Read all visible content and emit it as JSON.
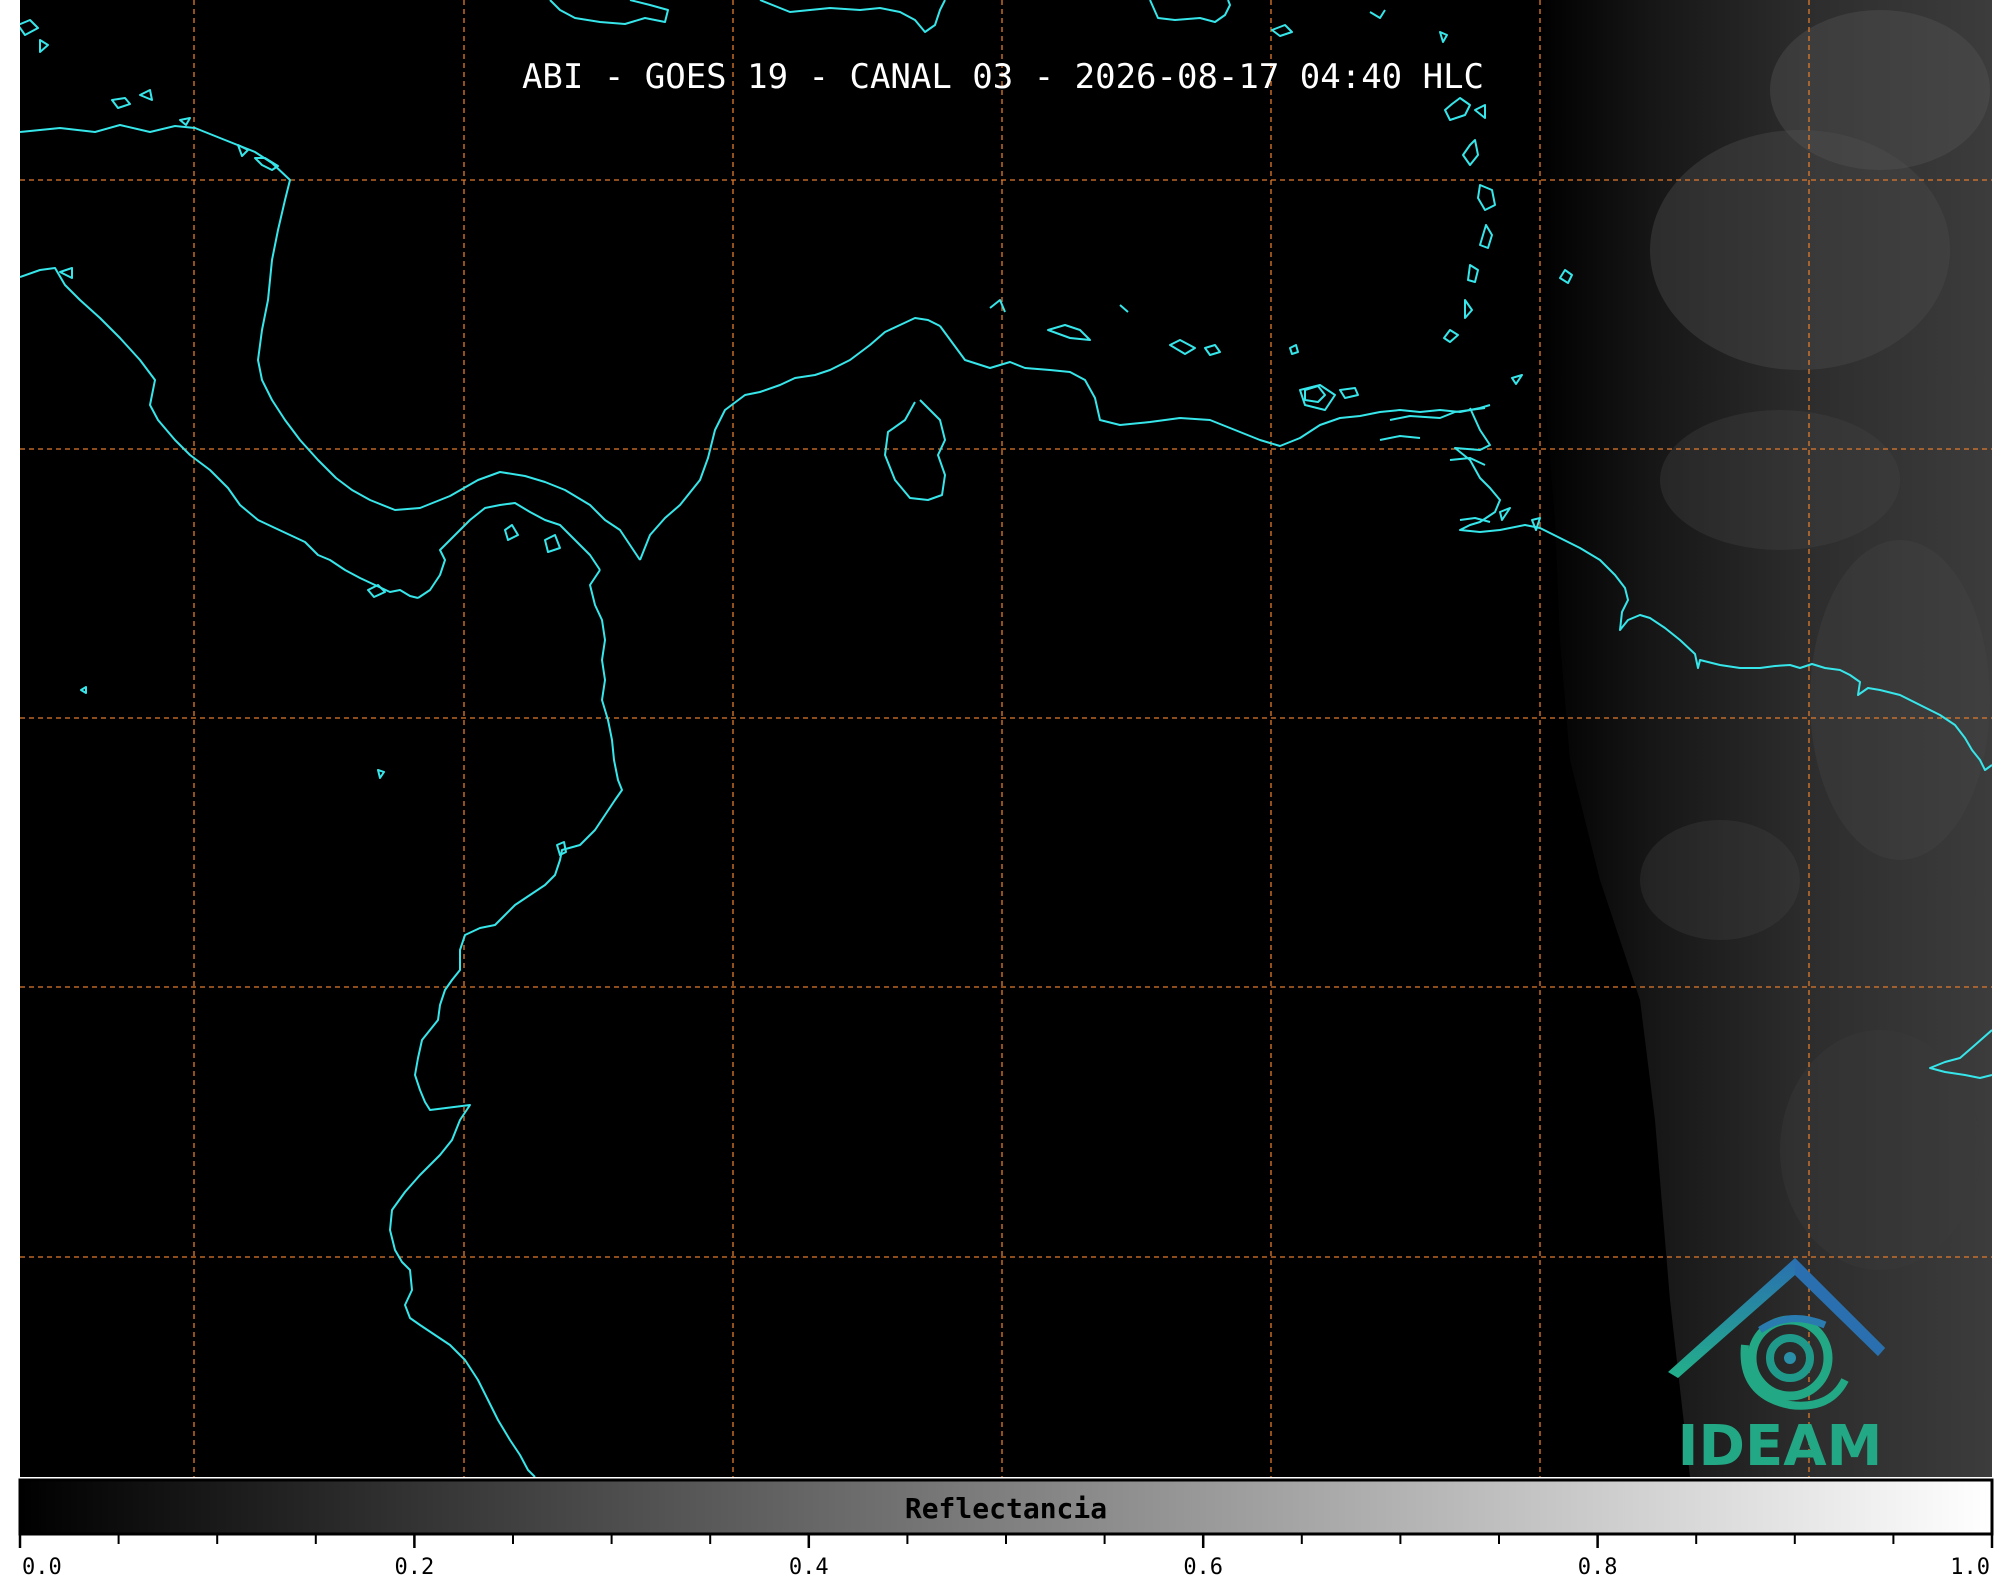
{
  "title": "ABI - GOES 19 - CANAL 03 - 2026-08-17 04:40 HLC",
  "logo": {
    "text": "IDEAM",
    "color": "#22a884",
    "arc_color": "#2a7bb0"
  },
  "colors": {
    "background": "#000000",
    "coastline": "#36e6ea",
    "gridline": "#e07a2c",
    "cloud_field": "#3a3a3a"
  },
  "grid": {
    "style": "dashed",
    "visible": true
  },
  "colorbar": {
    "label": "Reflectancia",
    "cmap": "gray",
    "range": [
      0.0,
      1.0
    ],
    "ticks": [
      {
        "value": 0.0,
        "label": "0.0"
      },
      {
        "value": 0.2,
        "label": "0.2"
      },
      {
        "value": 0.4,
        "label": "0.4"
      },
      {
        "value": 0.6,
        "label": "0.6"
      },
      {
        "value": 0.8,
        "label": "0.8"
      },
      {
        "value": 1.0,
        "label": "1.0"
      }
    ],
    "minor_step": 0.05
  }
}
